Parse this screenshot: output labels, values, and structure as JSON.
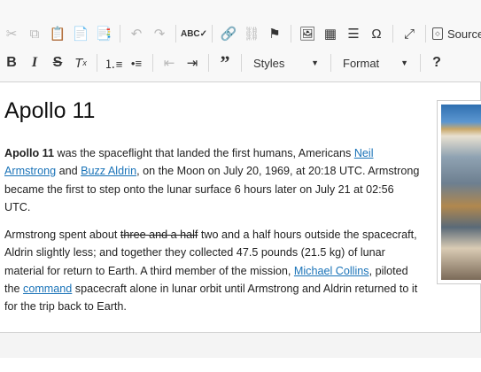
{
  "toolbar": {
    "row1": [
      "cut-icon",
      "copy-icon",
      "paste-icon",
      "paste-text-icon",
      "paste-word-icon",
      "undo-icon",
      "redo-icon",
      "spellcheck-icon",
      "link-icon",
      "unlink-icon",
      "anchor-icon",
      "image-icon",
      "table-icon",
      "horizontal-rule-icon",
      "special-char-icon",
      "maximize-icon"
    ],
    "source_label": "Source",
    "styles_label": "Styles",
    "format_label": "Format",
    "help_label": "?"
  },
  "document": {
    "title": "Apollo 11",
    "p1": {
      "bold": "Apollo 11",
      "t1": " was the spaceflight that landed the first humans, Americans ",
      "link1": "Neil Armstrong",
      "t2": " and ",
      "link2": "Buzz Aldrin",
      "t3": ", on the Moon on July 20, 1969, at 20:18 UTC. Armstrong became the first to step onto the lunar surface 6 hours later on July 21 at 02:56 UTC."
    },
    "p2": {
      "t1": "Armstrong spent about ",
      "strike": "three and a half",
      "t2": " two and a half hours outside the spacecraft, Aldrin slightly less; and together they collected 47.5 pounds (21.5 kg) of lunar material for return to Earth. A third member of the mission, ",
      "link1": "Michael Collins",
      "t3": ", piloted the ",
      "link2": "command",
      "t4": " spacecraft alone in lunar orbit until Armstrong and Aldrin returned to it for the trip back to Earth."
    }
  }
}
